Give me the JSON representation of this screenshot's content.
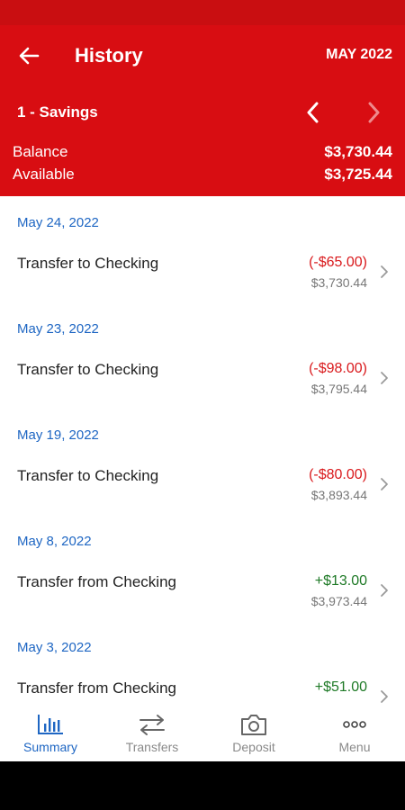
{
  "header": {
    "title": "History",
    "month": "MAY 2022",
    "account": "1 - Savings",
    "balance_label": "Balance",
    "balance_value": "$3,730.44",
    "available_label": "Available",
    "available_value": "$3,725.44"
  },
  "transactions": [
    {
      "date": "May 24, 2022",
      "description": "Transfer to Checking",
      "amount": "(-$65.00)",
      "balance": "$3,730.44"
    },
    {
      "date": "May 23, 2022",
      "description": "Transfer to Checking",
      "amount": "(-$98.00)",
      "balance": "$3,795.44"
    },
    {
      "date": "May 19, 2022",
      "description": "Transfer to Checking",
      "amount": "(-$80.00)",
      "balance": "$3,893.44"
    },
    {
      "date": "May 8, 2022",
      "description": "Transfer from Checking",
      "amount": "+$13.00",
      "balance": "$3,973.44"
    },
    {
      "date": "May 3, 2022",
      "description": "Transfer from Checking",
      "amount": "+$51.00",
      "balance": ""
    }
  ],
  "tabs": [
    {
      "label": "Summary",
      "icon": "bar-chart-icon",
      "active": true
    },
    {
      "label": "Transfers",
      "icon": "transfer-arrows-icon",
      "active": false
    },
    {
      "label": "Deposit",
      "icon": "camera-icon",
      "active": false
    },
    {
      "label": "Menu",
      "icon": "more-dots-icon",
      "active": false
    }
  ],
  "colors": {
    "brand_red": "#d80d12",
    "link_blue": "#1e66c3",
    "negative_red": "#d9191c",
    "positive_green": "#1f7a27"
  }
}
